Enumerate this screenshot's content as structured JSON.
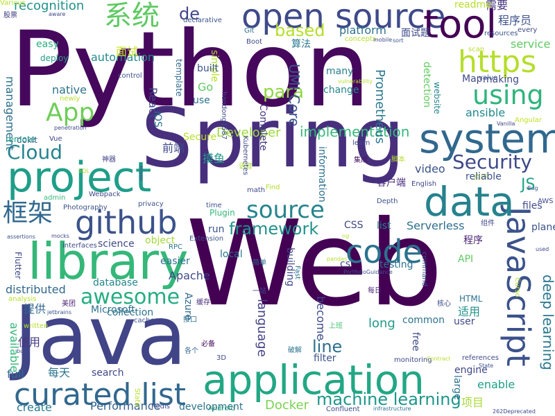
{
  "words": [
    {
      "text": "Python",
      "color": "#46085c"
    },
    {
      "text": "Web",
      "color": "#440154"
    },
    {
      "text": "Spring",
      "color": "#472f7d"
    },
    {
      "text": "Java",
      "color": "#414487"
    },
    {
      "text": "open source",
      "color": "#3e4a89"
    },
    {
      "text": "application",
      "color": "#22a785"
    },
    {
      "text": "system",
      "color": "#31688e"
    },
    {
      "text": "library",
      "color": "#35b779"
    },
    {
      "text": "project",
      "color": "#1f9e89"
    },
    {
      "text": "JavaScript",
      "color": "#3b528b"
    },
    {
      "text": "data",
      "color": "#26828e"
    },
    {
      "text": "code",
      "color": "#2c728e"
    },
    {
      "text": "github",
      "color": "#3b528b"
    },
    {
      "text": "curated list",
      "color": "#31688e"
    },
    {
      "text": "tool",
      "color": "#440154"
    },
    {
      "text": "https",
      "color": "#b5de2b"
    },
    {
      "text": "source",
      "color": "#25848e"
    },
    {
      "text": "系统",
      "color": "#5ec962"
    },
    {
      "text": "框架",
      "color": "#31688e"
    },
    {
      "text": "using",
      "color": "#2fb47c"
    },
    {
      "text": "App",
      "color": "#6ece58"
    },
    {
      "text": "awesome",
      "color": "#26ad81"
    },
    {
      "text": "Cloud",
      "color": "#25838e"
    },
    {
      "text": "Security",
      "color": "#3e4989"
    },
    {
      "text": "machine learning",
      "color": "#1f968b"
    },
    {
      "text": "framework",
      "color": "#21918c"
    },
    {
      "text": "based",
      "color": "#b5de2b"
    },
    {
      "text": "deep learning",
      "color": "#2a788e"
    },
    {
      "text": "para",
      "color": "#90d743"
    },
    {
      "text": "implementation",
      "color": "#35b779"
    },
    {
      "text": "Developer",
      "color": "#9bd93c"
    },
    {
      "text": "JS",
      "color": "#20a386"
    },
    {
      "text": "de",
      "color": "#404688"
    },
    {
      "text": "recognition",
      "color": "#21918c"
    },
    {
      "text": "platform",
      "color": "#2c728e"
    },
    {
      "text": "UMI Core",
      "color": "#3b528b"
    },
    {
      "text": "Prometheus",
      "color": "#2a788e"
    },
    {
      "text": "management",
      "color": "#2d708e"
    },
    {
      "text": "automation",
      "color": "#238a8d"
    },
    {
      "text": "native",
      "color": "#2c728e"
    },
    {
      "text": "distributed",
      "color": "#31688e"
    },
    {
      "text": "Apache",
      "color": "#3e4a89"
    },
    {
      "text": "Docker",
      "color": "#7ad151"
    },
    {
      "text": "Serverless",
      "color": "#2e6f8e"
    },
    {
      "text": "ansible",
      "color": "#23888e"
    },
    {
      "text": "service",
      "color": "#5ec962"
    },
    {
      "text": "available",
      "color": "#35b779"
    },
    {
      "text": "language",
      "color": "#424086"
    },
    {
      "text": "line",
      "color": "#2e6e8e"
    },
    {
      "text": "video",
      "color": "#3b528b"
    },
    {
      "text": "engine",
      "color": "#3f4788"
    },
    {
      "text": "long",
      "color": "#1f9a8a"
    },
    {
      "text": "enable",
      "color": "#1fa188"
    },
    {
      "text": "search",
      "color": "#3f4889"
    },
    {
      "text": "Performance",
      "color": "#34618d"
    },
    {
      "text": "create",
      "color": "#287c8e"
    },
    {
      "text": "full",
      "color": "#2e6e8e"
    },
    {
      "text": "项目",
      "color": "#a8db34"
    },
    {
      "text": "每天",
      "color": "#2c728e"
    },
    {
      "text": "使用",
      "color": "#453882"
    },
    {
      "text": "提供",
      "color": "#31678e"
    },
    {
      "text": "适用",
      "color": "#21918c"
    },
    {
      "text": "摸鱼",
      "color": "#1e9b8a"
    },
    {
      "text": "前端",
      "color": "#3f4889"
    },
    {
      "text": "面试",
      "color": "#c8e020"
    },
    {
      "text": "面试题",
      "color": "#3e4a89"
    },
    {
      "text": "算法",
      "color": "#2a788e"
    },
    {
      "text": "程序员",
      "color": "#3b528b"
    },
    {
      "text": "需要",
      "color": "#46337f"
    },
    {
      "text": "程序",
      "color": "#481f71"
    },
    {
      "text": "组件",
      "color": "#404588"
    },
    {
      "text": "每日",
      "color": "#482878"
    },
    {
      "text": "客户端",
      "color": "#472c7a"
    },
    {
      "text": "集成",
      "color": "#481668"
    },
    {
      "text": "必备",
      "color": "#46085c"
    },
    {
      "text": "破解",
      "color": "#2c728e"
    },
    {
      "text": "一站",
      "color": "#3e4989"
    },
    {
      "text": "神器",
      "color": "#414487"
    },
    {
      "text": "美团",
      "color": "#481f70"
    },
    {
      "text": "简单",
      "color": "#2d708e"
    },
    {
      "text": "上班",
      "color": "#44bf70"
    },
    {
      "text": "各个",
      "color": "#31688e"
    },
    {
      "text": "接口",
      "color": "#2d708e"
    },
    {
      "text": "核心",
      "color": "#3e4989"
    },
    {
      "text": "缓存",
      "color": "#472d7b"
    },
    {
      "text": "语音",
      "color": "#addc30"
    },
    {
      "text": "股票",
      "color": "#433e85"
    },
    {
      "text": "点评",
      "color": "#b8de29"
    },
    {
      "text": "脚本",
      "color": "#b5de2b"
    },
    {
      "text": "simple",
      "color": "#b5de2b"
    },
    {
      "text": "easy",
      "color": "#29af7f"
    },
    {
      "text": "deploy",
      "color": "#1f9e89"
    },
    {
      "text": "template",
      "color": "#31688e"
    },
    {
      "text": "built",
      "color": "#3b528b"
    },
    {
      "text": "Go",
      "color": "#5ec962"
    },
    {
      "text": "use",
      "color": "#2c728e"
    },
    {
      "text": "React",
      "color": "#3e4989"
    },
    {
      "text": "iOS",
      "color": "#2c728e"
    },
    {
      "text": "Complete",
      "color": "#453781"
    },
    {
      "text": "many",
      "color": "#287d8e"
    },
    {
      "text": "change",
      "color": "#25858e"
    },
    {
      "text": "making",
      "color": "#3e4989"
    },
    {
      "text": "Map",
      "color": "#3f4788"
    },
    {
      "text": "value",
      "color": "#3b528b"
    },
    {
      "text": "detection",
      "color": "#63cb5f"
    },
    {
      "text": "website",
      "color": "#25848e"
    },
    {
      "text": "Angular",
      "color": "#c2df23"
    },
    {
      "text": "Vanilla",
      "color": "#404588"
    },
    {
      "text": "Secure",
      "color": "#b8de29"
    },
    {
      "text": "Vue",
      "color": "#3f4788"
    },
    {
      "text": "dokit",
      "color": "#3b528b"
    },
    {
      "text": "remote",
      "color": "#1f9e89"
    },
    {
      "text": "Kubernetes",
      "color": "#3e4989"
    },
    {
      "text": "information",
      "color": "#2d708e"
    },
    {
      "text": "learn",
      "color": "#3e4989"
    },
    {
      "text": "reliable",
      "color": "#3b528b"
    },
    {
      "text": "English",
      "color": "#3e4989"
    },
    {
      "text": "Find",
      "color": "#b5de2b"
    },
    {
      "text": "math",
      "color": "#3e4989"
    },
    {
      "text": "time",
      "color": "#3b528b"
    },
    {
      "text": "Plugin",
      "color": "#35b779"
    },
    {
      "text": "privacy",
      "color": "#3b528b"
    },
    {
      "text": "Webpack",
      "color": "#3e4989"
    },
    {
      "text": "admin",
      "color": "#35b779"
    },
    {
      "text": "Photography",
      "color": "#3b528b"
    },
    {
      "text": "interfaces",
      "color": "#3e4989"
    },
    {
      "text": "science",
      "color": "#3e4989"
    },
    {
      "text": "object",
      "color": "#a0da39"
    },
    {
      "text": "RPC",
      "color": "#2c728e"
    },
    {
      "text": "Extension",
      "color": "#3b528b"
    },
    {
      "text": "easier",
      "color": "#2c728e"
    },
    {
      "text": "local",
      "color": "#2c728e"
    },
    {
      "text": "building",
      "color": "#3e4989"
    },
    {
      "text": "Fast",
      "color": "#2c728e"
    },
    {
      "text": "cs",
      "color": "#3e4989"
    },
    {
      "text": "list",
      "color": "#25848e"
    },
    {
      "text": "CSS",
      "color": "#3e4989"
    },
    {
      "text": "run",
      "color": "#3b528b"
    },
    {
      "text": "files",
      "color": "#3e4989"
    },
    {
      "text": "API",
      "color": "#5ec962"
    },
    {
      "text": "testing",
      "color": "#2c728e"
    },
    {
      "text": "database",
      "color": "#25848e"
    },
    {
      "text": "collection",
      "color": "#2c728e"
    },
    {
      "text": "Microsoft",
      "color": "#2c728e"
    },
    {
      "text": "Azure",
      "color": "#31688e"
    },
    {
      "text": "Flutter",
      "color": "#3e4989"
    },
    {
      "text": "analysis",
      "color": "#b5de2b"
    },
    {
      "text": "written",
      "color": "#b5de2b"
    },
    {
      "text": "cache",
      "color": "#3b528b"
    },
    {
      "text": "3D",
      "color": "#3e4989"
    },
    {
      "text": "Android",
      "color": "#35b779"
    },
    {
      "text": "development",
      "color": "#2c728e"
    },
    {
      "text": "Redis",
      "color": "#3e4989"
    },
    {
      "text": "Static",
      "color": "#b5de2b"
    },
    {
      "text": "filter",
      "color": "#3b528b"
    },
    {
      "text": "become",
      "color": "#3e4989"
    },
    {
      "text": "common",
      "color": "#2c728e"
    },
    {
      "text": "user",
      "color": "#3e4989"
    },
    {
      "text": "large",
      "color": "#2c728e"
    },
    {
      "text": "free",
      "color": "#3e4989"
    },
    {
      "text": "HTML",
      "color": "#2c728e"
    },
    {
      "text": "Curso",
      "color": "#b5de2b"
    },
    {
      "text": "command",
      "color": "#3b528b"
    },
    {
      "text": "monitoring",
      "color": "#3e4989"
    },
    {
      "text": "Contract",
      "color": "#b5de2b"
    },
    {
      "text": "references",
      "color": "#3e4989"
    },
    {
      "text": "State",
      "color": "#3b528b"
    },
    {
      "text": "Confluent",
      "color": "#3e4989"
    },
    {
      "text": "infrastructure",
      "color": "#2c728e"
    },
    {
      "text": "262Deprecated",
      "color": "#3e4989"
    },
    {
      "text": "readme",
      "color": "#b5de2b"
    },
    {
      "text": "resources",
      "color": "#3b528b"
    },
    {
      "text": "every",
      "color": "#3e4989"
    },
    {
      "text": "scan",
      "color": "#b5de2b"
    },
    {
      "text": "Git",
      "color": "#2c728e"
    },
    {
      "text": "Boot",
      "color": "#3e4989"
    },
    {
      "text": "declarative",
      "color": "#3b528b"
    },
    {
      "text": "concepts",
      "color": "#b5de2b"
    },
    {
      "text": "mobile",
      "color": "#3e4989"
    },
    {
      "text": "sort",
      "color": "#3b528b"
    },
    {
      "text": "aware",
      "color": "#3e4989"
    },
    {
      "text": "control",
      "color": "#3b528b"
    },
    {
      "text": "newly",
      "color": "#b5de2b"
    },
    {
      "text": "handong1587",
      "color": "#3e4989"
    },
    {
      "text": "vulnerability",
      "color": "#b5de2b"
    },
    {
      "text": "penetration",
      "color": "#3e4989"
    },
    {
      "text": "SQL",
      "color": "#b5de2b"
    },
    {
      "text": "mosn",
      "color": "#3e4989"
    },
    {
      "text": "Depth",
      "color": "#3b528b"
    },
    {
      "text": "AWS",
      "color": "#3e4989"
    },
    {
      "text": "Bug",
      "color": "#3b528b"
    },
    {
      "text": "used",
      "color": "#3e4989"
    },
    {
      "text": "plane",
      "color": "#3b528b"
    },
    {
      "text": "ng",
      "color": "#b5de2b"
    },
    {
      "text": "PortfolioGuidance",
      "color": "#3b528b"
    },
    {
      "text": "pandas",
      "color": "#b5de2b"
    },
    {
      "text": "mocks",
      "color": "#3e4989"
    },
    {
      "text": "assertions",
      "color": "#3b528b"
    },
    {
      "text": "build",
      "color": "#3e4989"
    },
    {
      "text": "jetbrains",
      "color": "#3b528b"
    },
    {
      "text": "Various",
      "color": "#b5de2b"
    }
  ]
}
